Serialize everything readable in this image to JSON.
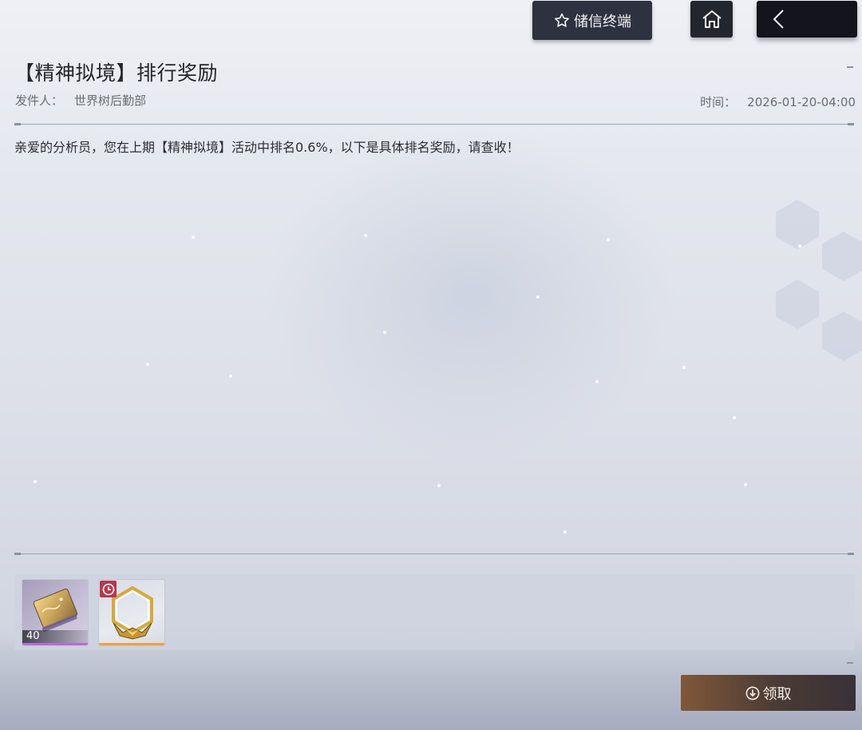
{
  "top_bar": {
    "terminal_label": "储信终端"
  },
  "mail": {
    "title": "【精神拟境】排行奖励",
    "sender_label": "发件人：",
    "sender_value": "世界树后勤部",
    "time_label": "时间：",
    "time_value": "2026-01-20-04:00",
    "body": "亲爱的分析员，您在上期【精神拟境】活动中排名0.6%，以下是具体排名奖励，请查收！"
  },
  "rewards": [
    {
      "quantity": "40",
      "rarity_color": "#b76bd8"
    },
    {
      "quantity": "",
      "rarity_color": "#f0a23e",
      "limited_time": true
    }
  ],
  "claim": {
    "label": "领取"
  },
  "colors": {
    "button_dark": "#2e3140",
    "claim_gold": "#80583a",
    "timer_red": "#b8384c"
  }
}
